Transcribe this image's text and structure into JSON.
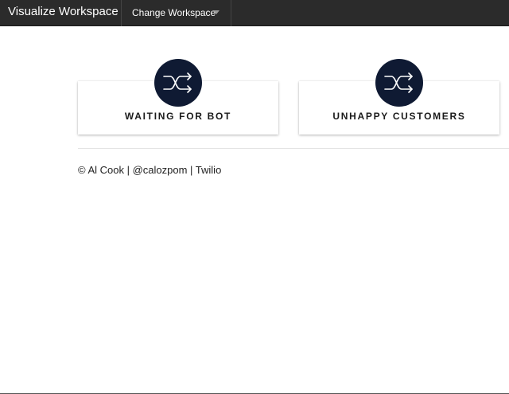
{
  "navbar": {
    "brand": "Visualize Workspace",
    "dropdown_label": "Change Workspace",
    "dropdown_icon": "caret-down-icon"
  },
  "cards": [
    {
      "label": "WAITING FOR BOT",
      "icon": "shuffle-icon",
      "icon_bg": "#0f1a33"
    },
    {
      "label": "UNHAPPY CUSTOMERS",
      "icon": "shuffle-icon",
      "icon_bg": "#0f1a33"
    }
  ],
  "footer": {
    "text": "© Al Cook | @calozpom | Twilio"
  }
}
